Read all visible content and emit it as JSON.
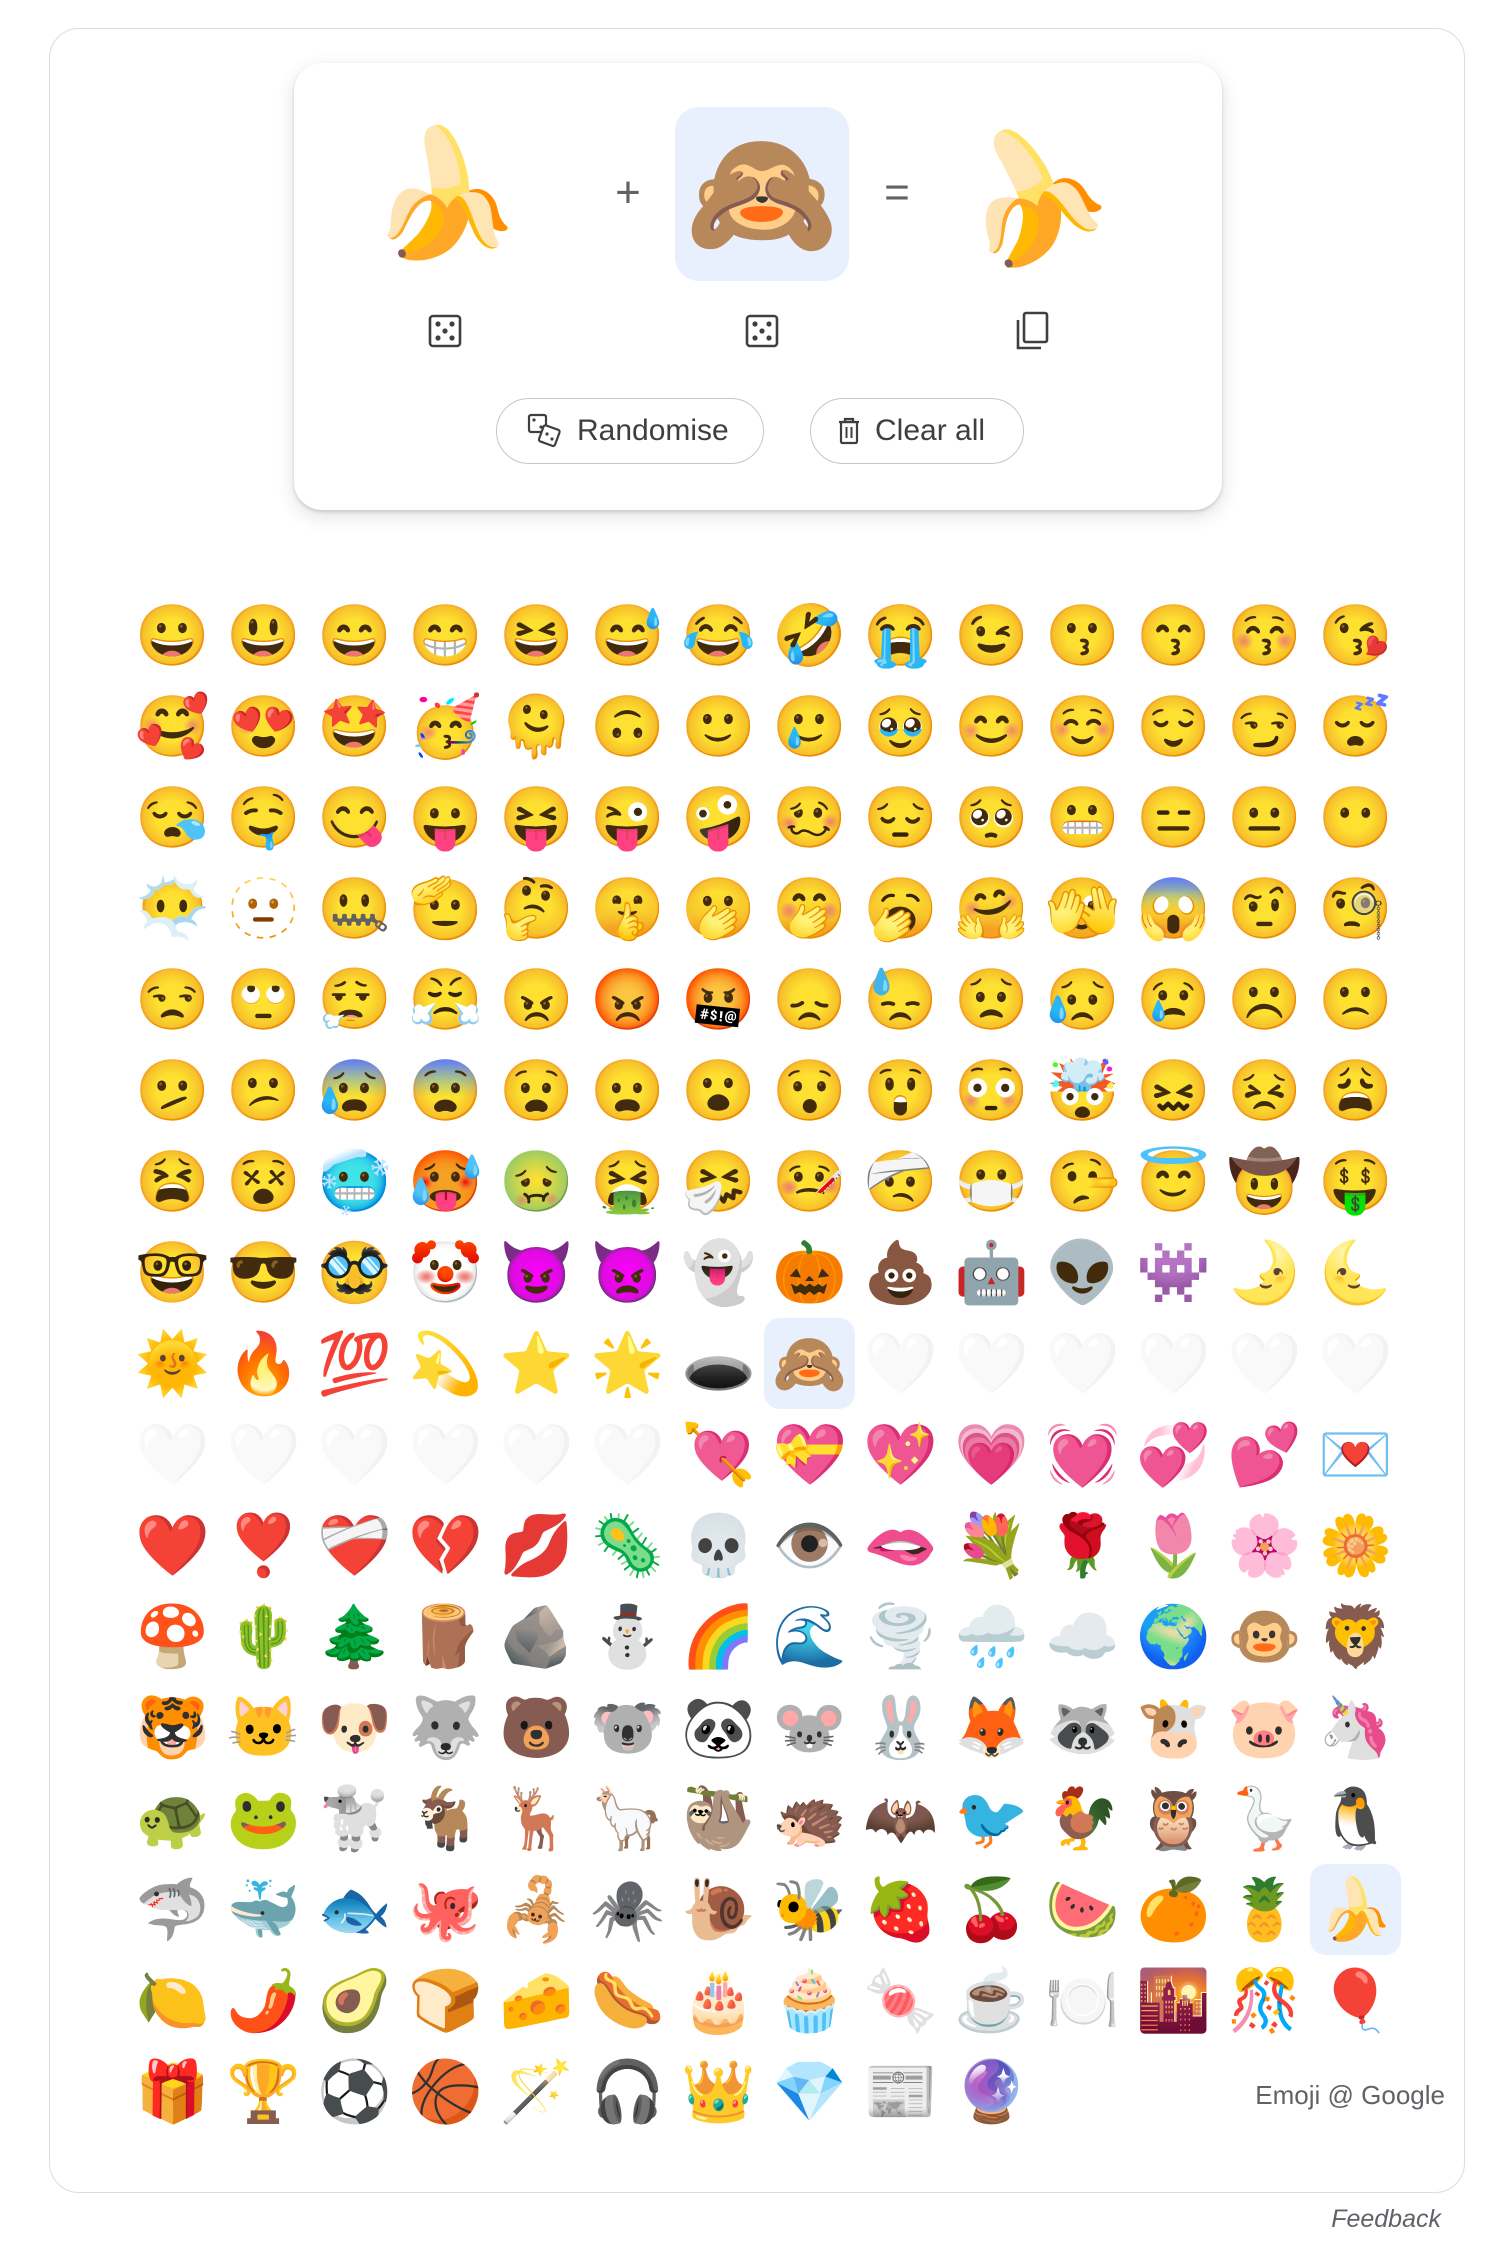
{
  "mixer": {
    "left_emoji": "🍌",
    "plus": "+",
    "right_emoji": "🙈",
    "equals": "=",
    "result_emoji": "🍌",
    "randomise_label": "Randomise",
    "clear_label": "Clear all"
  },
  "emoji_grid": [
    "😀",
    "😃",
    "😄",
    "😁",
    "😆",
    "😅",
    "😂",
    "🤣",
    "😭",
    "😉",
    "😗",
    "😙",
    "😚",
    "😘",
    "🥰",
    "😍",
    "🤩",
    "🥳",
    "🫠",
    "🙃",
    "🙂",
    "🥲",
    "🥹",
    "😊",
    "☺️",
    "😌",
    "😏",
    "😴",
    "😪",
    "🤤",
    "😋",
    "😛",
    "😝",
    "😜",
    "🤪",
    "🥴",
    "😔",
    "🥺",
    "😬",
    "😑",
    "😐",
    "😶",
    "😶‍🌫️",
    "🫥",
    "🤐",
    "🫡",
    "🤔",
    "🤫",
    "🫢",
    "🤭",
    "🥱",
    "🤗",
    "🫣",
    "😱",
    "🤨",
    "🧐",
    "😒",
    "🙄",
    "😮‍💨",
    "😤",
    "😠",
    "😡",
    "🤬",
    "😞",
    "😓",
    "😟",
    "😥",
    "😢",
    "☹️",
    "🙁",
    "🫤",
    "😕",
    "😰",
    "😨",
    "😧",
    "😦",
    "😮",
    "😯",
    "😲",
    "😳",
    "🤯",
    "😖",
    "😣",
    "😩",
    "😫",
    "😵",
    "🥶",
    "🥵",
    "🤢",
    "🤮",
    "🤧",
    "🤒",
    "🤕",
    "😷",
    "🤥",
    "😇",
    "🤠",
    "🤑",
    "🤓",
    "😎",
    "🥸",
    "🤡",
    "😈",
    "👿",
    "👻",
    "🎃",
    "💩",
    "🤖",
    "👽",
    "👾",
    "🌛",
    "🌜",
    "🌞",
    "🔥",
    "💯",
    "💫",
    "⭐",
    "🌟",
    "🕳️",
    "🙈",
    "🤍",
    "🤍",
    "🤍",
    "🤍",
    "🤍",
    "🤍",
    "🤍",
    "🤍",
    "🤍",
    "🤍",
    "🤍",
    "🤍",
    "💘",
    "💝",
    "💖",
    "💗",
    "💓",
    "💞",
    "💕",
    "💌",
    "❤️",
    "❣️",
    "❤️‍🩹",
    "💔",
    "💋",
    "🦠",
    "💀",
    "👁️",
    "🫦",
    "💐",
    "🌹",
    "🌷",
    "🌸",
    "🌼",
    "🍄",
    "🌵",
    "🌲",
    "🪵",
    "🪨",
    "⛄",
    "🌈",
    "🌊",
    "🌪️",
    "🌧️",
    "☁️",
    "🌍",
    "🐵",
    "🦁",
    "🐯",
    "🐱",
    "🐶",
    "🐺",
    "🐻",
    "🐨",
    "🐼",
    "🐭",
    "🐰",
    "🦊",
    "🦝",
    "🐮",
    "🐷",
    "🦄",
    "🐢",
    "🐸",
    "🐩",
    "🐐",
    "🦌",
    "🦙",
    "🦥",
    "🦔",
    "🦇",
    "🐦",
    "🐓",
    "🦉",
    "🪿",
    "🐧",
    "🦈",
    "🐳",
    "🐟",
    "🐙",
    "🦂",
    "🕷️",
    "🐌",
    "🐝",
    "🍓",
    "🍒",
    "🍉",
    "🍊",
    "🍍",
    "🍌",
    "🍋",
    "🌶️",
    "🥑",
    "🍞",
    "🧀",
    "🌭",
    "🎂",
    "🧁",
    "🍬",
    "☕",
    "🍽️",
    "🌇",
    "🎊",
    "🎈",
    "🎁",
    "🏆",
    "⚽",
    "🏀",
    "🪄",
    "🎧",
    "👑",
    "💎",
    "📰",
    "🔮"
  ],
  "disabled_indices": [
    120,
    121,
    122,
    123,
    124,
    125,
    126,
    127,
    128,
    129,
    130,
    131
  ],
  "selected_indices": [
    119,
    209
  ],
  "credit": "Emoji @ Google",
  "feedback": "Feedback"
}
